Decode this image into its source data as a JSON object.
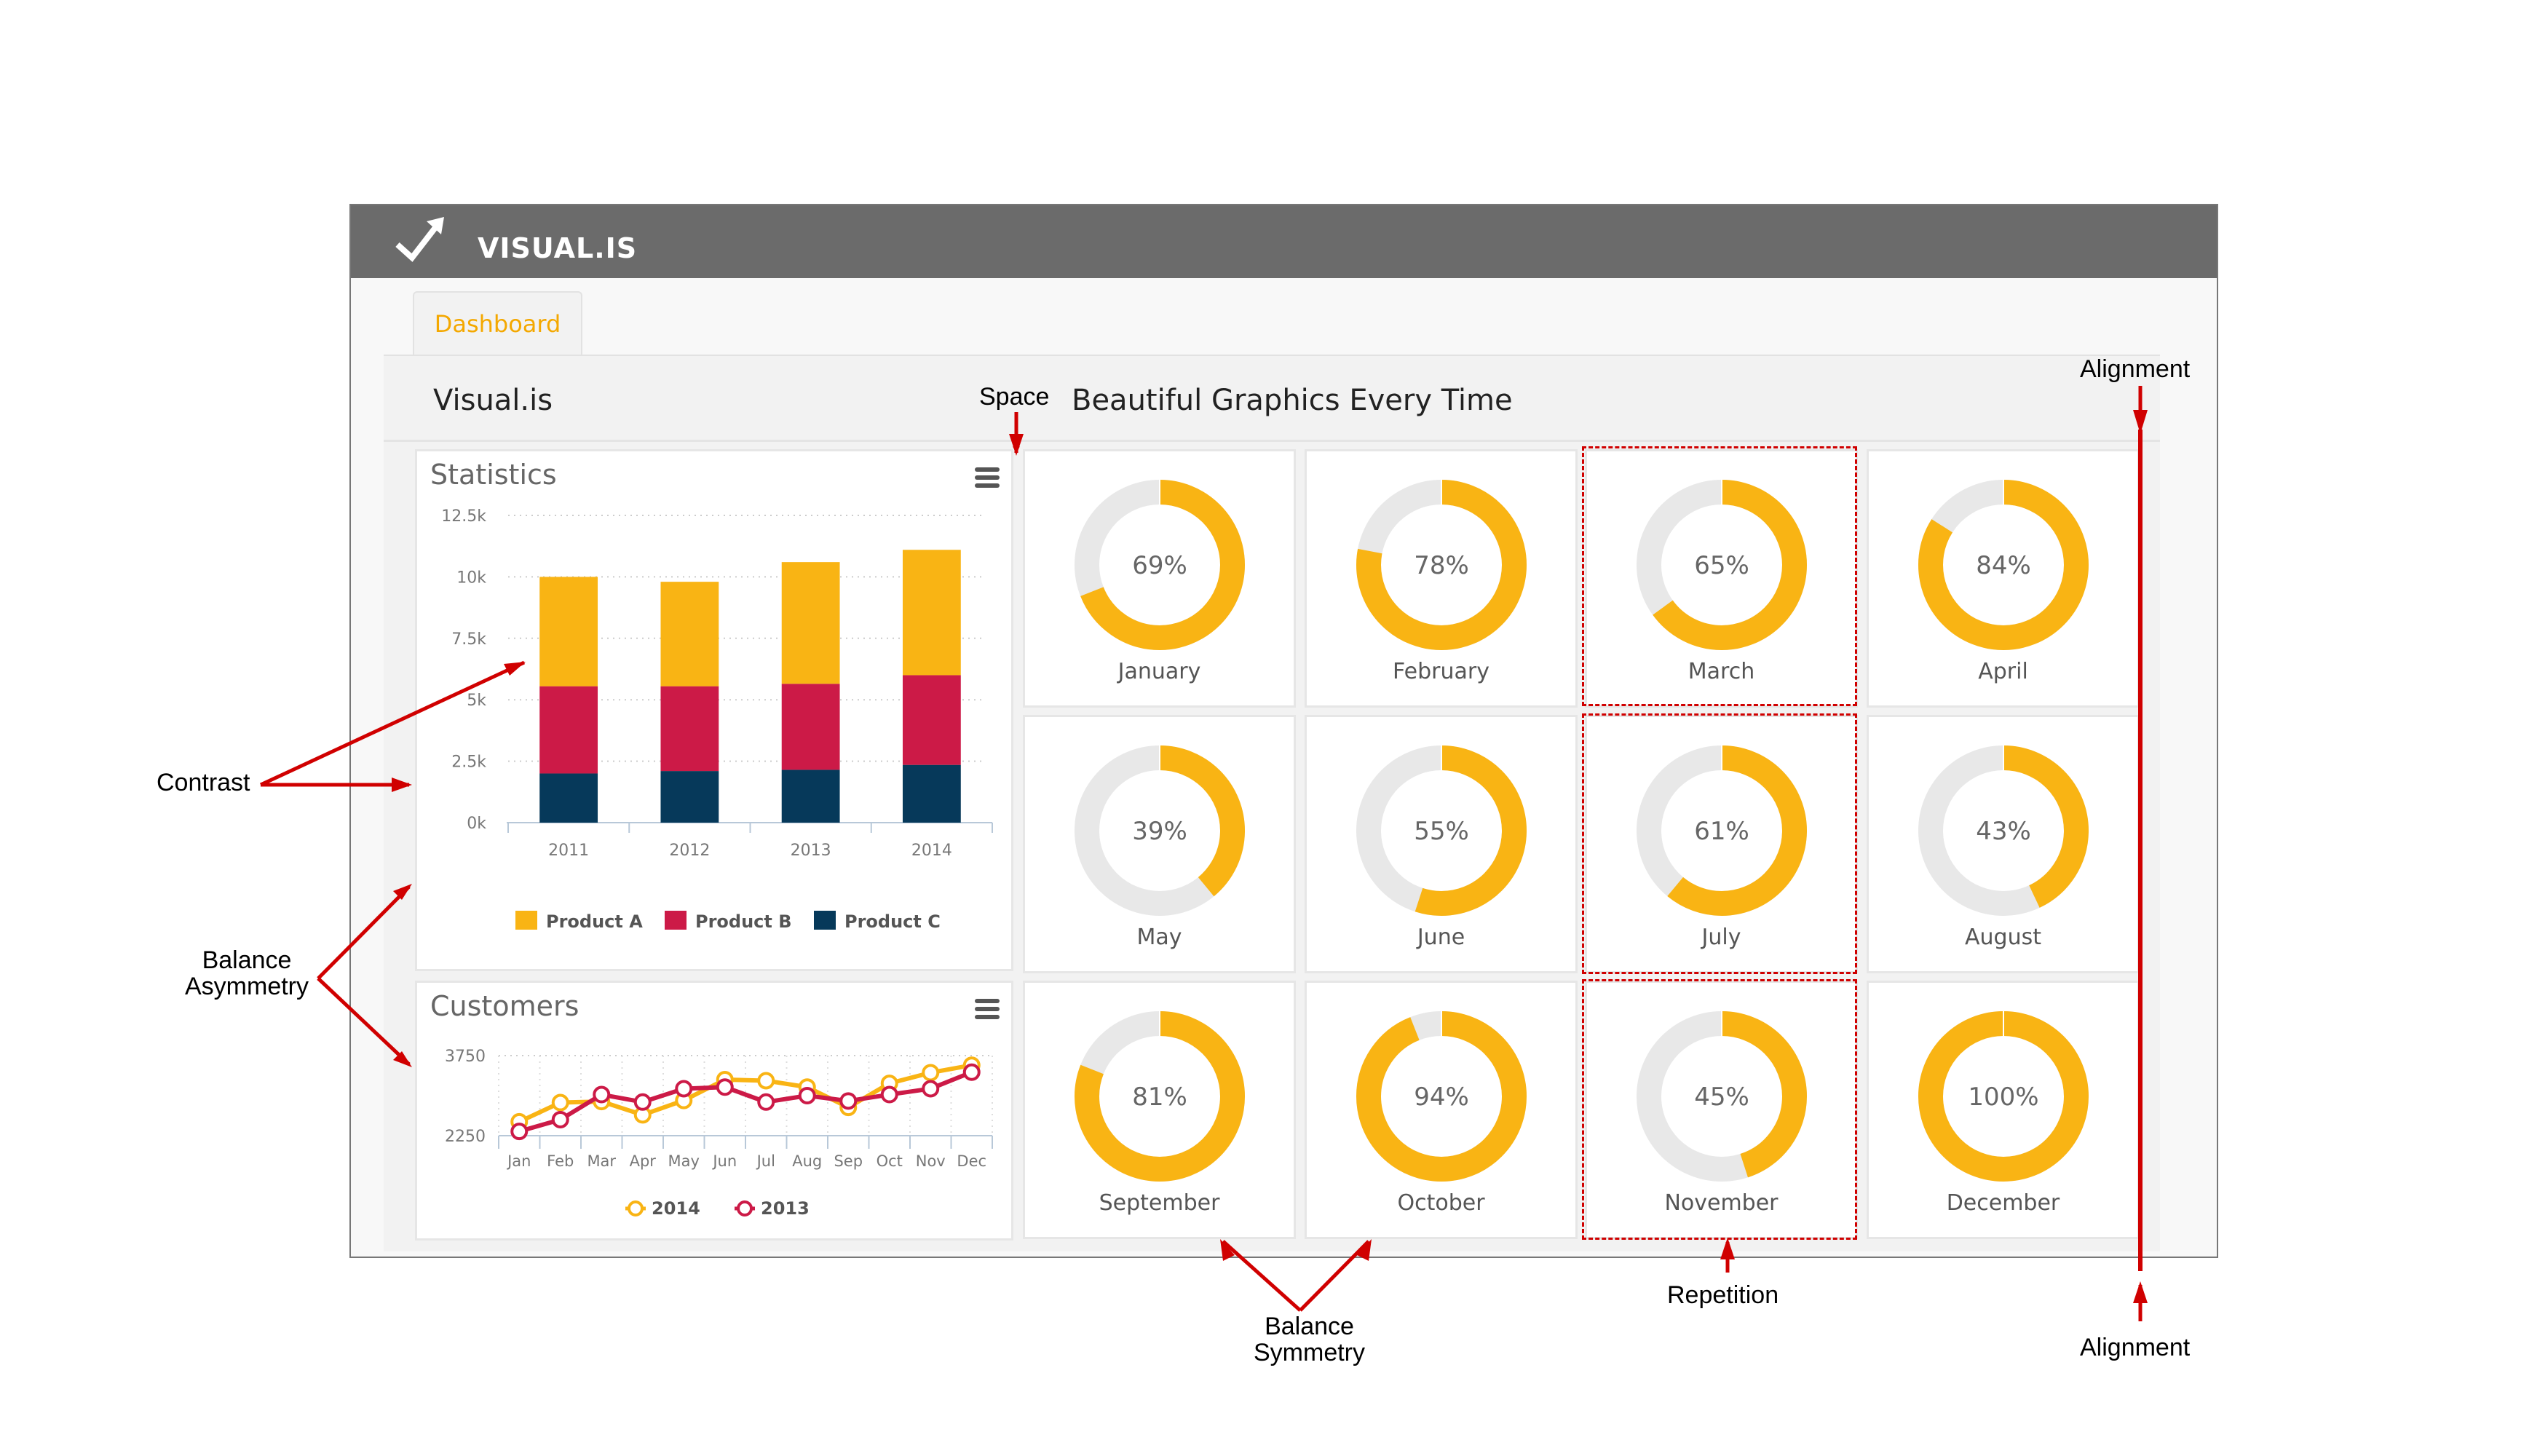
{
  "header": {
    "brand": "VISUAL.IS",
    "logo_icon": "trend-arrow-icon"
  },
  "tabs": [
    {
      "label": "Dashboard",
      "active": true
    }
  ],
  "page": {
    "title": "Visual.is",
    "tagline": "Beautiful Graphics Every Time"
  },
  "colors": {
    "accent": "#f4a800",
    "productA": "#f9b414",
    "productB": "#cc1a47",
    "productC": "#06395a",
    "line2014": "#f9b414",
    "line2013": "#cc1a47",
    "donut_track": "#e8e8e8",
    "annotation": "#d00000",
    "header_bar": "#6b6b6b"
  },
  "statistics": {
    "title": "Statistics",
    "menu_icon": "hamburger-menu-icon"
  },
  "customers": {
    "title": "Customers",
    "menu_icon": "hamburger-menu-icon"
  },
  "chart_data": [
    {
      "type": "bar",
      "stacked": true,
      "title": "Statistics",
      "categories": [
        "2011",
        "2012",
        "2013",
        "2014"
      ],
      "series": [
        {
          "name": "Product A",
          "values": [
            4450,
            4250,
            4950,
            5100
          ]
        },
        {
          "name": "Product B",
          "values": [
            3550,
            3450,
            3500,
            3650
          ]
        },
        {
          "name": "Product C",
          "values": [
            2000,
            2100,
            2150,
            2350
          ]
        }
      ],
      "yticks": [
        "0k",
        "2.5k",
        "5k",
        "7.5k",
        "10k",
        "12.5k"
      ],
      "ylim": [
        0,
        12500
      ],
      "grid": true,
      "legend": "bottom"
    },
    {
      "type": "line",
      "title": "Customers",
      "categories": [
        "Jan",
        "Feb",
        "Mar",
        "Apr",
        "May",
        "Jun",
        "Jul",
        "Aug",
        "Sep",
        "Oct",
        "Nov",
        "Dec"
      ],
      "series": [
        {
          "name": "2014",
          "values": [
            2510,
            2870,
            2890,
            2640,
            2910,
            3300,
            3280,
            3160,
            2780,
            3230,
            3430,
            3570
          ]
        },
        {
          "name": "2013",
          "values": [
            2330,
            2550,
            3020,
            2880,
            3130,
            3160,
            2880,
            3000,
            2900,
            3020,
            3130,
            3440
          ]
        }
      ],
      "yticks": [
        "2250",
        "3750"
      ],
      "ylim": [
        2250,
        3850
      ],
      "grid": true,
      "legend": "bottom"
    },
    {
      "type": "pie",
      "variant": "donut-grid",
      "items": [
        {
          "label": "January",
          "value": 69,
          "text": "69%"
        },
        {
          "label": "February",
          "value": 78,
          "text": "78%"
        },
        {
          "label": "March",
          "value": 65,
          "text": "65%"
        },
        {
          "label": "April",
          "value": 84,
          "text": "84%"
        },
        {
          "label": "May",
          "value": 39,
          "text": "39%"
        },
        {
          "label": "June",
          "value": 55,
          "text": "55%"
        },
        {
          "label": "July",
          "value": 61,
          "text": "61%"
        },
        {
          "label": "August",
          "value": 43,
          "text": "43%"
        },
        {
          "label": "September",
          "value": 81,
          "text": "81%"
        },
        {
          "label": "October",
          "value": 94,
          "text": "94%"
        },
        {
          "label": "November",
          "value": 45,
          "text": "45%"
        },
        {
          "label": "December",
          "value": 100,
          "text": "100%"
        }
      ]
    }
  ],
  "annotations": {
    "space": "Space",
    "alignment_top": "Alignment",
    "alignment_bottom": "Alignment",
    "contrast": "Contrast",
    "balance_asym_1": "Balance",
    "balance_asym_2": "Asymmetry",
    "balance_sym_1": "Balance",
    "balance_sym_2": "Symmetry",
    "repetition": "Repetition"
  }
}
